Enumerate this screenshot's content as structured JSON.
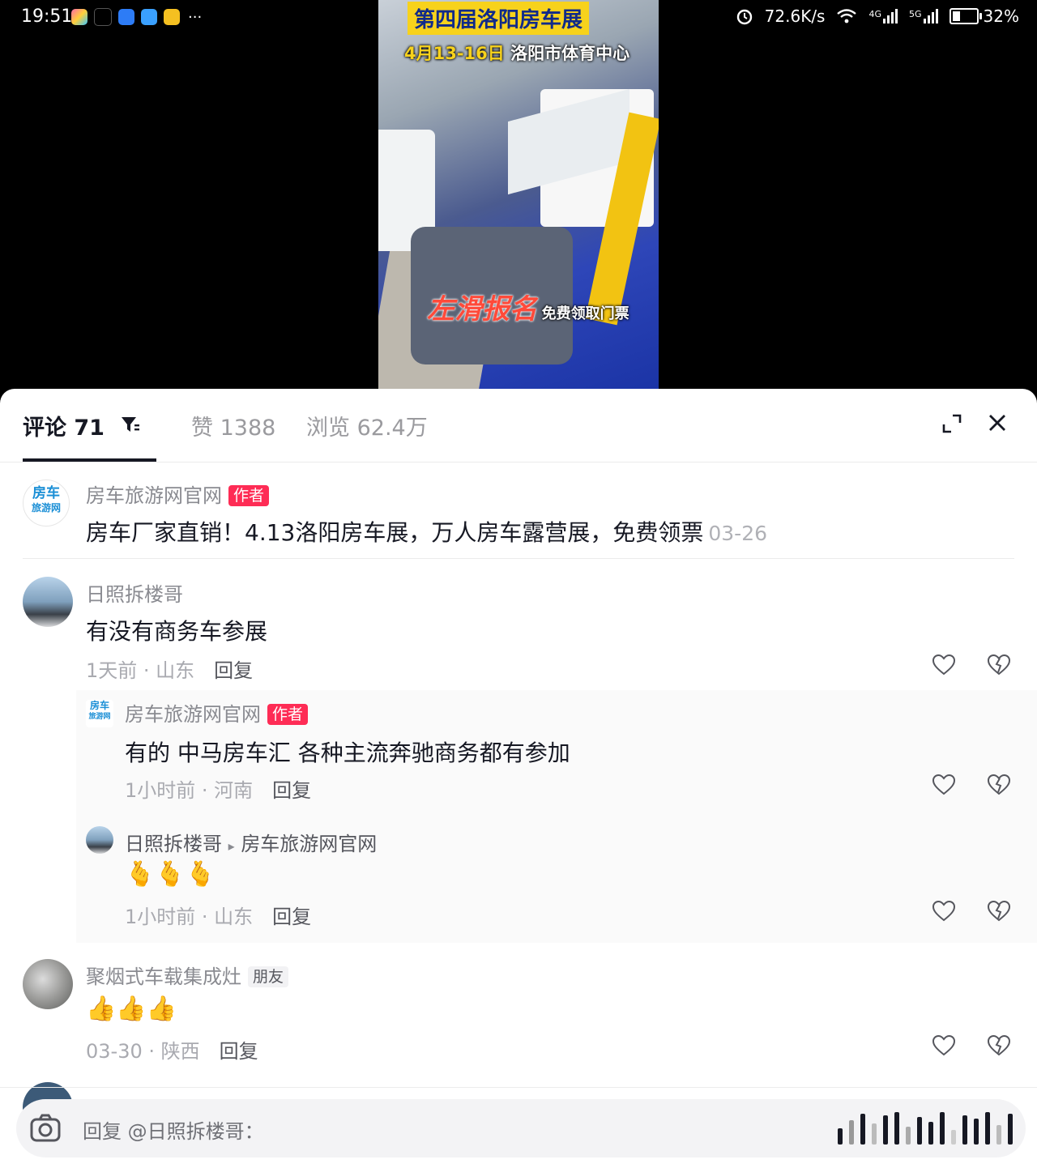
{
  "status_bar": {
    "time": "19:51",
    "network_speed": "72.6K/s",
    "signal_1": "4G",
    "signal_2": "5G",
    "battery": "32%",
    "battery_level": 0.32,
    "more": "···"
  },
  "video": {
    "title": "第四届洛阳房车展",
    "date": "4月13-16日",
    "venue": "洛阳市体育中心",
    "cta_big": "左滑报名",
    "cta_small": "免费领取门票"
  },
  "sheet": {
    "tabs": [
      {
        "label": "评论 71"
      },
      {
        "label": "赞 1388"
      },
      {
        "label": "浏览 62.4万"
      }
    ]
  },
  "comments": {
    "pinned": {
      "avatar_text_1": "房车",
      "avatar_text_2": "旅游网",
      "name": "房车旅游网官网",
      "tag": "作者",
      "text": "房车厂家直销！4.13洛阳房车展，万人房车露营展，免费领票",
      "date": "03-26"
    },
    "c1": {
      "name": "日照拆楼哥",
      "text": "有没有商务车参展",
      "time": "1天前 · 山东",
      "reply": "回复",
      "replies": [
        {
          "avatar_text_1": "房车",
          "avatar_text_2": "旅游网",
          "name": "房车旅游网官网",
          "tag": "作者",
          "text": "有的 中马房车汇  各种主流奔驰商务都有参加",
          "time": "1小时前 · 河南",
          "reply": "回复"
        },
        {
          "name": "日照拆楼哥",
          "arrow": "▸",
          "reply_to": "房车旅游网官网",
          "text": "🫰🫰🫰",
          "time": "1小时前 · 山东",
          "reply": "回复"
        }
      ]
    },
    "c2": {
      "name": "聚烟式车载集成灶",
      "tag": "朋友",
      "text": "👍👍👍",
      "time": "03-30 · 陕西",
      "reply": "回复"
    }
  },
  "input": {
    "placeholder": "回复 @日照拆楼哥："
  },
  "colors": {
    "accent_red": "#fe2c55",
    "text_primary": "#161823",
    "text_secondary": "#8a8b91"
  }
}
